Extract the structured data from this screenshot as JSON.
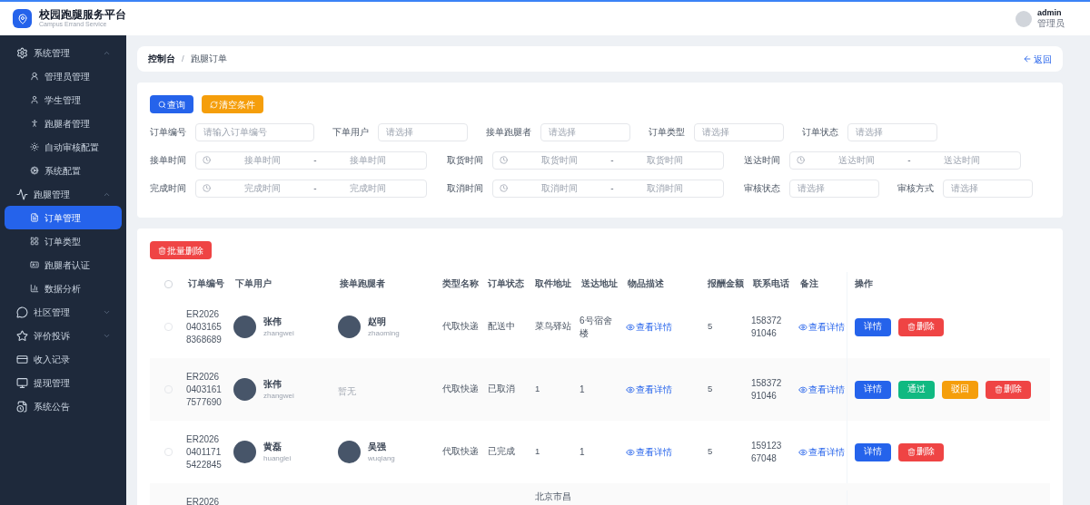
{
  "header": {
    "title": "校园跑腿服务平台",
    "subtitle": "Campus Errand Service",
    "user": {
      "name": "admin",
      "role": "管理员"
    }
  },
  "sidebar": {
    "items": [
      {
        "label": "系统管理",
        "expanded": true,
        "selected": false,
        "children": [
          {
            "label": "管理员管理",
            "selected": false
          },
          {
            "label": "学生管理",
            "selected": false
          },
          {
            "label": "跑腿者管理",
            "selected": false
          },
          {
            "label": "自动审核配置",
            "selected": false
          },
          {
            "label": "系统配置",
            "selected": false
          }
        ]
      },
      {
        "label": "跑腿管理",
        "expanded": true,
        "selected": false,
        "children": [
          {
            "label": "订单管理",
            "selected": true
          },
          {
            "label": "订单类型",
            "selected": false
          },
          {
            "label": "跑腿者认证",
            "selected": false
          },
          {
            "label": "数据分析",
            "selected": false
          }
        ]
      },
      {
        "label": "社区管理",
        "expanded": false,
        "selected": false
      },
      {
        "label": "评价投诉",
        "expanded": false,
        "selected": false
      },
      {
        "label": "收入记录",
        "selected": false
      },
      {
        "label": "提现管理",
        "selected": false
      },
      {
        "label": "系统公告",
        "selected": false
      }
    ]
  },
  "breadcrumb": {
    "items": [
      "控制台",
      "跑腿订单"
    ],
    "separator": "/",
    "back": "返回"
  },
  "filters": {
    "buttons": [
      {
        "label": "查询",
        "kind": "primary"
      },
      {
        "label": "清空条件",
        "kind": "warning"
      }
    ],
    "rows": [
      {
        "fields": [
          {
            "label": "订单编号",
            "kind": "text",
            "placeholder": "请输入订单编号"
          },
          {
            "label": "下单用户",
            "kind": "select",
            "placeholder": "请选择"
          },
          {
            "label": "接单跑腿者",
            "kind": "select",
            "placeholder": "请选择"
          },
          {
            "label": "订单类型",
            "kind": "select",
            "placeholder": "请选择"
          },
          {
            "label": "订单状态",
            "kind": "select",
            "placeholder": "请选择"
          }
        ]
      },
      {
        "fields": [
          {
            "label": "接单时间",
            "kind": "range",
            "start_placeholder": "接单时间",
            "separator": "-",
            "end_placeholder": "接单时间"
          },
          {
            "label": "取货时间",
            "kind": "range",
            "start_placeholder": "取货时间",
            "separator": "-",
            "end_placeholder": "取货时间"
          },
          {
            "label": "送达时间",
            "kind": "range",
            "start_placeholder": "送达时间",
            "separator": "-",
            "end_placeholder": "送达时间"
          }
        ]
      },
      {
        "fields": [
          {
            "label": "完成时间",
            "kind": "range",
            "start_placeholder": "完成时间",
            "separator": "-",
            "end_placeholder": "完成时间"
          },
          {
            "label": "取消时间",
            "kind": "range",
            "start_placeholder": "取消时间",
            "separator": "-",
            "end_placeholder": "取消时间"
          },
          {
            "label": "审核状态",
            "kind": "select",
            "placeholder": "请选择"
          },
          {
            "label": "审核方式",
            "kind": "select",
            "placeholder": "请选择"
          }
        ]
      }
    ]
  },
  "table": {
    "batch_delete": "批量删除",
    "header_checked": false,
    "columns": [
      "订单编号",
      "下单用户",
      "接单跑腿者",
      "类型名称",
      "订单状态",
      "取件地址",
      "送达地址",
      "物品描述",
      "报酬金额",
      "联系电话",
      "备注",
      "操作"
    ],
    "rows": [
      {
        "checked": false,
        "order_no": "ER202604031658368689",
        "user": {
          "name": "张伟",
          "username": "zhangwei"
        },
        "runner": {
          "name": "赵明",
          "username": "zhaoming"
        },
        "type": "代取快递",
        "status": "配送中",
        "pickup": "菜鸟驿站",
        "delivery": "6号宿舍楼",
        "description": "查看详情",
        "amount": "5",
        "phone": "15837291046",
        "remark": "查看详情",
        "actions": [
          {
            "label": "详情",
            "kind": "detail"
          },
          {
            "label": "删除",
            "kind": "delete"
          }
        ]
      },
      {
        "checked": false,
        "order_no": "ER202604031617577690",
        "user": {
          "name": "张伟",
          "username": "zhangwei"
        },
        "runner": null,
        "runner_empty": "暂无",
        "type": "代取快递",
        "status": "已取消",
        "pickup": "1",
        "delivery": "1",
        "description": "查看详情",
        "amount": "5",
        "phone": "15837291046",
        "remark": "查看详情",
        "actions": [
          {
            "label": "详情",
            "kind": "detail"
          },
          {
            "label": "通过",
            "kind": "approve"
          },
          {
            "label": "驳回",
            "kind": "reject"
          },
          {
            "label": "删除",
            "kind": "delete"
          }
        ]
      },
      {
        "checked": false,
        "order_no": "ER202604011715422845",
        "user": {
          "name": "黄磊",
          "username": "huanglei"
        },
        "runner": {
          "name": "吴强",
          "username": "wuqiang"
        },
        "type": "代取快递",
        "status": "已完成",
        "pickup": "1",
        "delivery": "1",
        "description": "查看详情",
        "amount": "5",
        "phone": "15912367048",
        "remark": "查看详情",
        "actions": [
          {
            "label": "详情",
            "kind": "detail"
          },
          {
            "label": "删除",
            "kind": "delete"
          }
        ]
      },
      {
        "order_no": "ER2026",
        "pickup": "北京市昌"
      }
    ]
  }
}
